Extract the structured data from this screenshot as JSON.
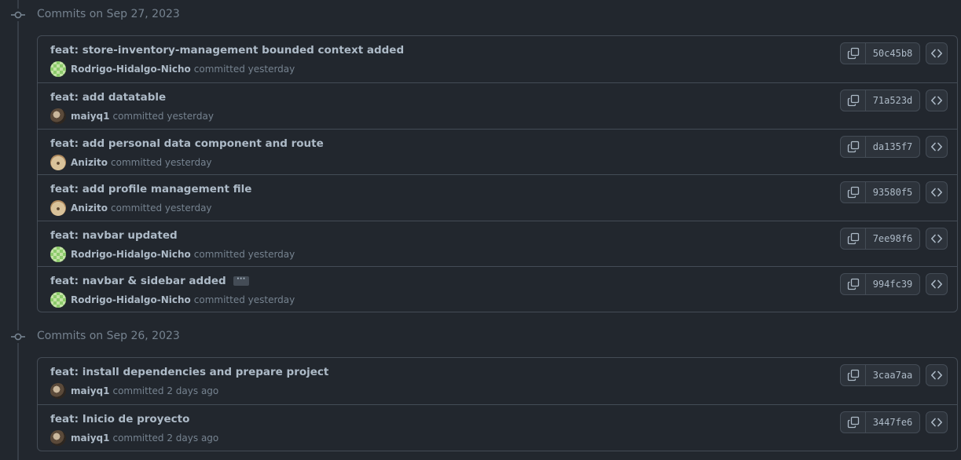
{
  "groups": [
    {
      "title": "Commits on Sep 27, 2023",
      "commits": [
        {
          "message": "feat: store-inventory-management bounded context added",
          "author": "Rodrigo-Hidalgo-Nicho",
          "time": "committed yesterday",
          "sha": "50c45b8",
          "avatar": "green",
          "has_more": false
        },
        {
          "message": "feat: add datatable",
          "author": "maiyq1",
          "time": "committed yesterday",
          "sha": "71a523d",
          "avatar": "photo",
          "has_more": false
        },
        {
          "message": "feat: add personal data component and route",
          "author": "Anizito",
          "time": "committed yesterday",
          "sha": "da135f7",
          "avatar": "dog",
          "has_more": false
        },
        {
          "message": "feat: add profile management file",
          "author": "Anizito",
          "time": "committed yesterday",
          "sha": "93580f5",
          "avatar": "dog",
          "has_more": false
        },
        {
          "message": "feat: navbar updated",
          "author": "Rodrigo-Hidalgo-Nicho",
          "time": "committed yesterday",
          "sha": "7ee98f6",
          "avatar": "green",
          "has_more": false
        },
        {
          "message": "feat: navbar & sidebar added",
          "author": "Rodrigo-Hidalgo-Nicho",
          "time": "committed yesterday",
          "sha": "994fc39",
          "avatar": "green",
          "has_more": true
        }
      ]
    },
    {
      "title": "Commits on Sep 26, 2023",
      "commits": [
        {
          "message": "feat: install dependencies and prepare project",
          "author": "maiyq1",
          "time": "committed 2 days ago",
          "sha": "3caa7aa",
          "avatar": "photo",
          "has_more": false
        },
        {
          "message": "feat: Inicio de proyecto",
          "author": "maiyq1",
          "time": "committed 2 days ago",
          "sha": "3447fe6",
          "avatar": "photo",
          "has_more": false
        }
      ]
    }
  ],
  "more_label": "···",
  "icons": {
    "commit": "git-commit-icon",
    "copy": "copy-icon",
    "browse": "code-icon"
  },
  "colors": {
    "background": "#22272e",
    "border": "#444c56",
    "text": "#adbac7",
    "muted": "#768390"
  }
}
